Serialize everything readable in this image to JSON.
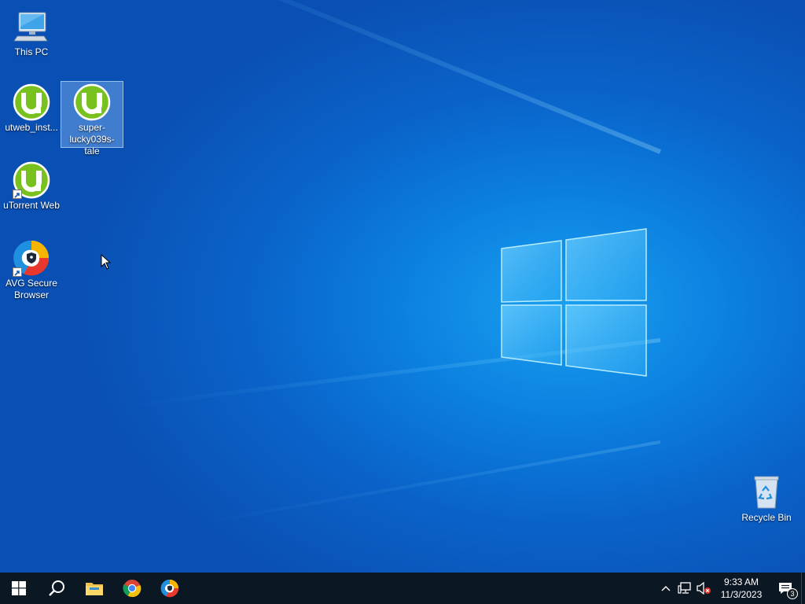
{
  "desktop": {
    "icons": [
      {
        "label": "This PC",
        "icon": "this-pc-icon"
      },
      {
        "label": "utweb_inst...",
        "icon": "utorrent-icon"
      },
      {
        "label": "super-lucky039s-tale",
        "icon": "utorrent-icon"
      },
      {
        "label": "uTorrent Web",
        "icon": "utorrent-icon"
      },
      {
        "label": "AVG Secure Browser",
        "icon": "avg-browser-icon"
      },
      {
        "label": "Recycle Bin",
        "icon": "recycle-bin-icon"
      }
    ]
  },
  "taskbar": {
    "pinned": [
      {
        "name": "start",
        "icon": "windows-start-icon"
      },
      {
        "name": "search",
        "icon": "search-icon"
      },
      {
        "name": "file-explorer",
        "icon": "folder-icon"
      },
      {
        "name": "chrome",
        "icon": "chrome-icon"
      },
      {
        "name": "avg-secure-browser",
        "icon": "avg-browser-icon"
      }
    ],
    "tray": {
      "time": "9:33 AM",
      "date": "11/3/2023",
      "notification_count": "3"
    }
  },
  "colors": {
    "taskbar_bg": "#0c1724",
    "desktop_blue": "#0a63c9",
    "utorrent_green": "#78c11e"
  }
}
